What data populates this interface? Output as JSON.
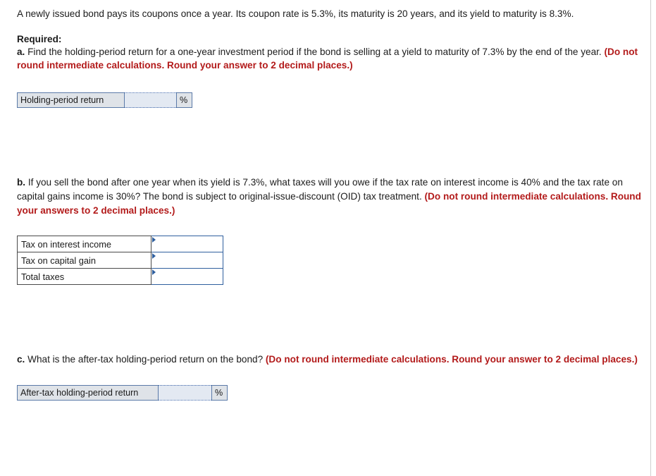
{
  "document": {
    "intro": "A newly issued bond pays its coupons once a year. Its coupon rate is 5.3%, its maturity is 20 years, and its yield to maturity is 8.3%.",
    "required_label": "Required:",
    "questions": [
      {
        "letter": "a.",
        "text": " Find the holding-period return for a one-year investment period if the bond is selling at a yield to maturity of 7.3% by the end of the year. ",
        "instruction": "(Do not round intermediate calculations. Round your answer to 2 decimal places.)"
      },
      {
        "letter": "b.",
        "text": " If you sell the bond after one year when its yield is 7.3%, what taxes will you owe if the tax rate on interest income is 40% and the tax rate on capital gains income is 30%? The bond is subject to original-issue-discount (OID) tax treatment. ",
        "instruction": "(Do not round intermediate calculations. Round your answers to 2 decimal places.)"
      },
      {
        "letter": "c.",
        "text": " What is the after-tax holding-period return on the bond? ",
        "instruction": "(Do not round intermediate calculations. Round your answer to 2 decimal places.)"
      }
    ],
    "answer_a": {
      "label": "Holding-period return",
      "value": "",
      "unit": "%"
    },
    "answer_b": {
      "rows": [
        {
          "label": "Tax on interest income",
          "value": ""
        },
        {
          "label": "Tax on capital gain",
          "value": ""
        },
        {
          "label": "Total taxes",
          "value": ""
        }
      ]
    },
    "answer_c": {
      "label": "After-tax holding-period return",
      "value": "",
      "unit": "%"
    },
    "colors": {
      "instruction_red": "#b31b1b",
      "input_border_blue": "#2f5f9e",
      "label_fill_gray": "#dfe3e8"
    }
  }
}
